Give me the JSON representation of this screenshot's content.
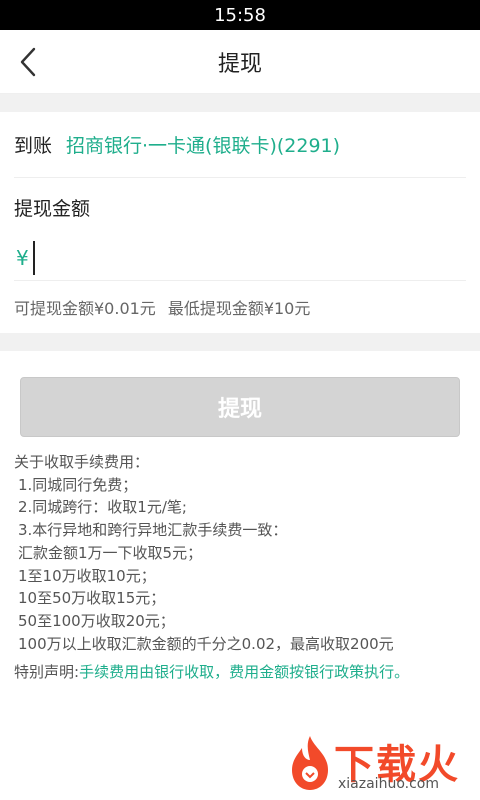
{
  "status_bar": {
    "time": "15:58"
  },
  "header": {
    "title": "提现",
    "back_icon": "chevron-left-icon"
  },
  "account": {
    "label": "到账",
    "value": "招商银行·一卡通(银联卡)(2291)"
  },
  "amount": {
    "title": "提现金额",
    "currency_symbol": "¥",
    "value": ""
  },
  "hints": {
    "available": "可提现金额¥0.01元",
    "minimum": "最低提现金额¥10元"
  },
  "withdraw_button": {
    "label": "提现"
  },
  "fee_notes": {
    "heading": "关于收取手续费用：",
    "items": [
      "1.同城同行免费；",
      "2.同城跨行：收取1元/笔;",
      "3.本行异地和跨行异地汇款手续费一致：",
      "汇款金额1万一下收取5元；",
      "1至10万收取10元；",
      "10至50万收取15元；",
      "50至100万收取20元；",
      "100万以上收取汇款金额的千分之0.02，最高收取200元"
    ],
    "declaration_label": "特别声明:",
    "declaration_text": "手续费用由银行收取，费用金额按银行政策执行。"
  },
  "watermark": {
    "brand": "下载火",
    "url": "xiazaihuo.com"
  },
  "colors": {
    "accent": "#1fae8c",
    "button_disabled": "#d4d4d4",
    "watermark": "#f24a2a",
    "background_gap": "#f1f1f1"
  }
}
